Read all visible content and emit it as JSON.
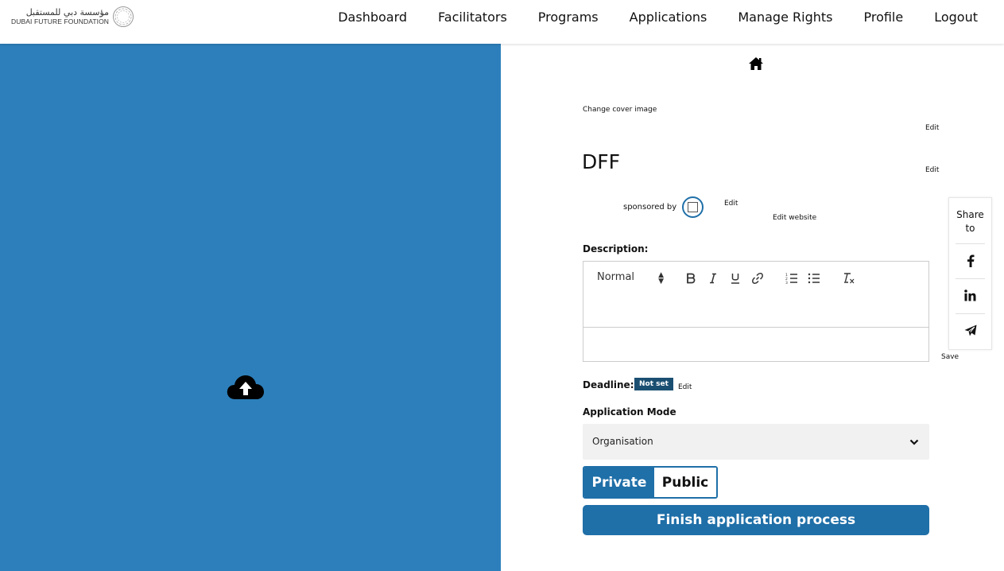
{
  "header": {
    "logo_arabic": "مؤسسة دبي للمستقبل",
    "logo_english": "DUBAI FUTURE FOUNDATION",
    "nav": [
      "Dashboard",
      "Facilitators",
      "Programs",
      "Applications",
      "Manage Rights",
      "Profile",
      "Logout"
    ]
  },
  "cover": {
    "upload_icon": "cloud-upload-icon",
    "background_color": "#2c7fbb"
  },
  "program": {
    "home_icon": "home-icon",
    "change_cover_label": "Change cover image",
    "edit_label": "Edit",
    "title": "DFF",
    "sponsored_by_label": "sponsored by",
    "edit_website_label": "Edit website",
    "description_label": "Description:",
    "editor": {
      "format_select": "Normal",
      "buttons": [
        "bold-icon",
        "italic-icon",
        "underline-icon",
        "link-icon",
        "ordered-list-icon",
        "bullet-list-icon",
        "clear-format-icon"
      ]
    },
    "save_label": "Save",
    "deadline_label": "Deadline:",
    "deadline_value": "Not set",
    "application_mode_label": "Application Mode",
    "application_mode_value": "Organisation",
    "visibility": {
      "private_label": "Private",
      "public_label": "Public",
      "selected": "Private"
    },
    "finish_label": "Finish application process"
  },
  "share": {
    "title_line1": "Share",
    "title_line2": "to",
    "icons": [
      "facebook-icon",
      "linkedin-icon",
      "telegram-icon"
    ]
  },
  "colors": {
    "accent": "#1f6fa8",
    "badge": "#1b4f72"
  }
}
